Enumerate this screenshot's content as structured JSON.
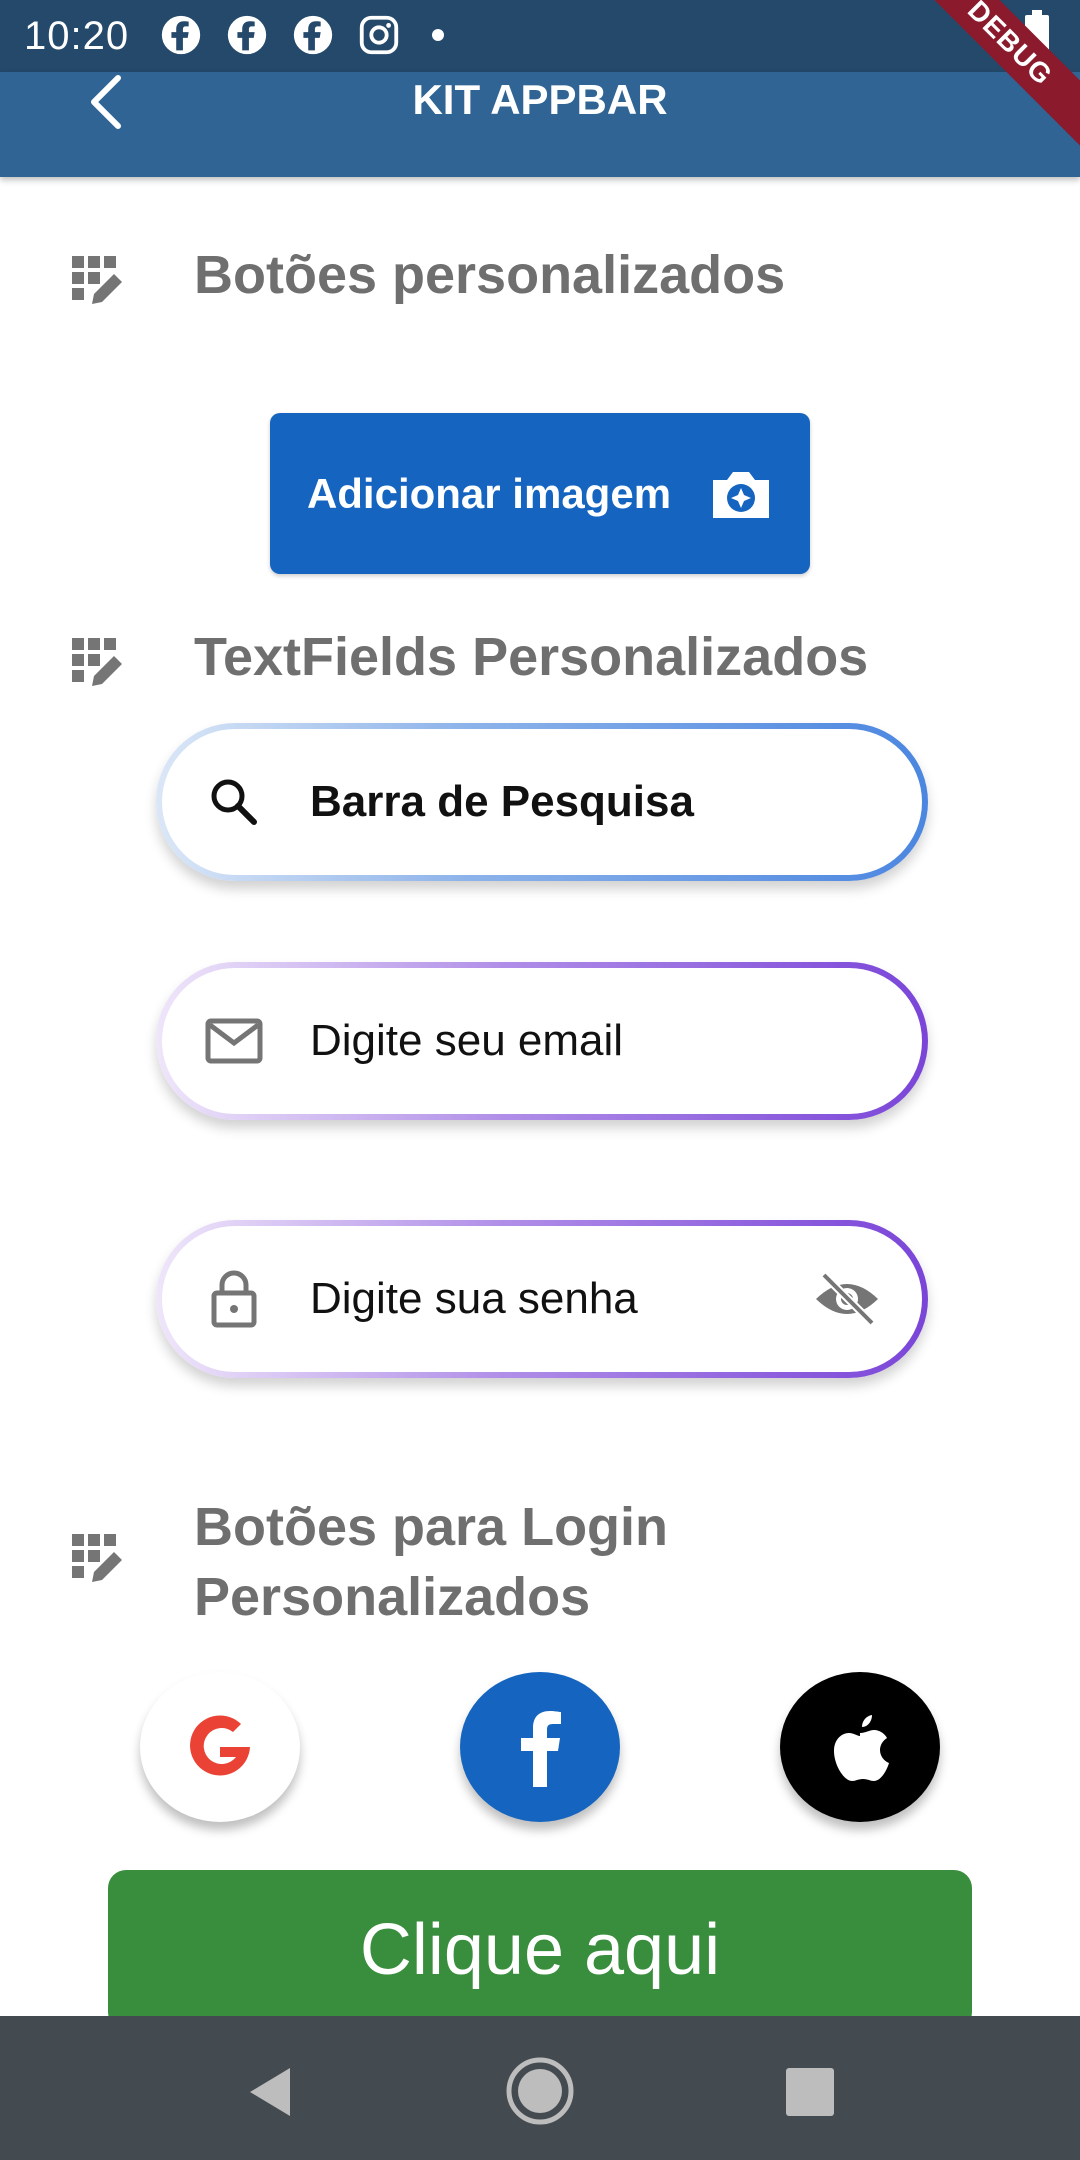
{
  "status_bar": {
    "time": "10:20",
    "notification_icons": [
      "facebook-icon",
      "facebook-icon",
      "facebook-icon",
      "instagram-icon"
    ],
    "right_icons": [
      "wifi-icon",
      "battery-icon"
    ]
  },
  "app_bar": {
    "title": "KIT APPBAR",
    "debug_label": "DEBUG"
  },
  "sections": {
    "buttons": {
      "title": "Botões personalizados"
    },
    "textfields": {
      "title": "TextFields Personalizados"
    },
    "login": {
      "title": "Botões para Login Personalizados"
    }
  },
  "add_image_button": {
    "label": "Adicionar imagem"
  },
  "fields": {
    "search": {
      "text": "Barra de Pesquisa"
    },
    "email": {
      "text": "Digite seu email"
    },
    "password": {
      "text": "Digite sua senha"
    }
  },
  "social_buttons": [
    "google",
    "facebook",
    "apple"
  ],
  "click_button": {
    "label": "Clique aqui"
  },
  "colors": {
    "status_bar": "#24496b",
    "app_bar": "#2f6495",
    "primary_button": "#1565c0",
    "click_button": "#388e3c",
    "nav_bar": "#434a50"
  }
}
